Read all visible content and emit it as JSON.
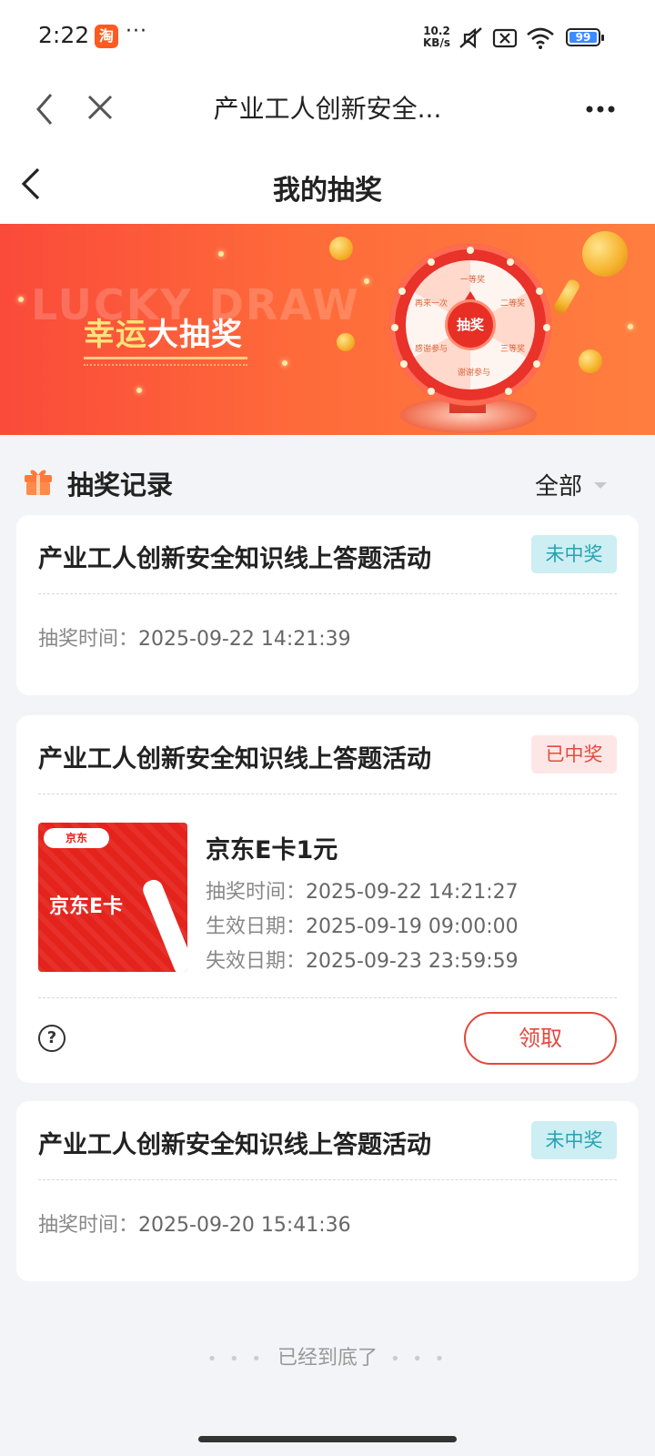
{
  "status_bar": {
    "time": "2:22",
    "app_icon_text": "淘",
    "more_dots": "···",
    "net_speed_top": "10.2",
    "net_speed_bottom": "KB/s",
    "battery": "99"
  },
  "title_bar": {
    "title": "产业工人创新安全..."
  },
  "page_header": {
    "title": "我的抽奖"
  },
  "banner": {
    "watermark": "LUCKY DRAW",
    "title_highlight": "幸运",
    "title_rest": "大抽奖",
    "wheel_button": "抽奖",
    "wheel_labels": [
      "一等奖",
      "二等奖",
      "三等奖",
      "谢谢参与",
      "感谢参与",
      "再来一次"
    ]
  },
  "records": {
    "title": "抽奖记录",
    "filter_label": "全部",
    "time_label": "抽奖时间：",
    "effective_label": "生效日期：",
    "expire_label": "失效日期：",
    "items": [
      {
        "activity": "产业工人创新安全知识线上答题活动",
        "status": "未中奖",
        "draw_time": "2025-09-22 14:21:39"
      },
      {
        "activity": "产业工人创新安全知识线上答题活动",
        "status": "已中奖",
        "prize_name": "京东E卡1元",
        "prize_image_logo": "京东",
        "prize_image_text": "京东E卡",
        "draw_time": "2025-09-22 14:21:27",
        "effective_date": "2025-09-19 09:00:00",
        "expire_date": "2025-09-23 23:59:59",
        "help": "?",
        "claim_button": "领取"
      },
      {
        "activity": "产业工人创新安全知识线上答题活动",
        "status": "未中奖",
        "draw_time": "2025-09-20 15:41:36"
      }
    ]
  },
  "footer": {
    "end_text": "已经到底了",
    "dots": "• • •"
  },
  "colors": {
    "accent_red": "#e4473a",
    "lose_badge_bg": "#cdeef2",
    "lose_badge_text": "#26a2b2",
    "win_badge_bg": "#fde7e6",
    "win_badge_text": "#e64a3c",
    "page_bg": "#f3f4f8"
  }
}
